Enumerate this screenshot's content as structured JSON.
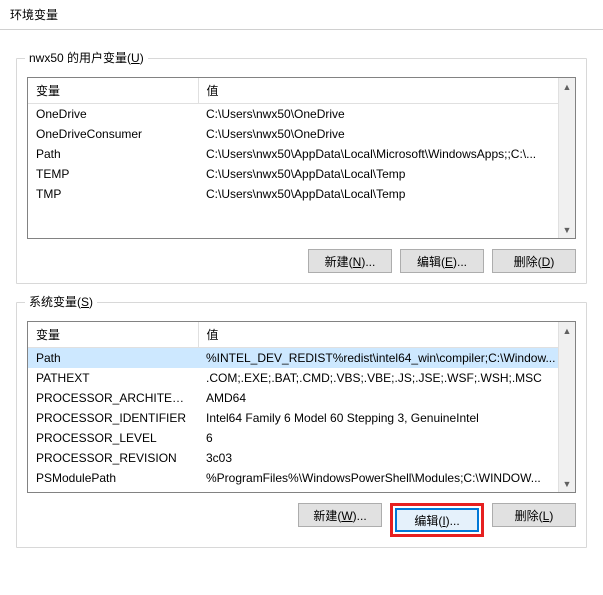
{
  "title": "环境变量",
  "user_group": {
    "label_prefix": "nwx50 的用户变量(",
    "label_key": "U",
    "label_suffix": ")",
    "headers": {
      "var": "变量",
      "val": "值"
    },
    "rows": [
      {
        "var": "OneDrive",
        "val": "C:\\Users\\nwx50\\OneDrive"
      },
      {
        "var": "OneDriveConsumer",
        "val": "C:\\Users\\nwx50\\OneDrive"
      },
      {
        "var": "Path",
        "val": "C:\\Users\\nwx50\\AppData\\Local\\Microsoft\\WindowsApps;;C:\\..."
      },
      {
        "var": "TEMP",
        "val": "C:\\Users\\nwx50\\AppData\\Local\\Temp"
      },
      {
        "var": "TMP",
        "val": "C:\\Users\\nwx50\\AppData\\Local\\Temp"
      }
    ],
    "buttons": {
      "new_pre": "新建(",
      "new_key": "N",
      "new_post": ")...",
      "edit_pre": "编辑(",
      "edit_key": "E",
      "edit_post": ")...",
      "del_pre": "删除(",
      "del_key": "D",
      "del_post": ")"
    }
  },
  "system_group": {
    "label_prefix": "系统变量(",
    "label_key": "S",
    "label_suffix": ")",
    "headers": {
      "var": "变量",
      "val": "值"
    },
    "rows": [
      {
        "var": "Path",
        "val": "%INTEL_DEV_REDIST%redist\\intel64_win\\compiler;C:\\Window..."
      },
      {
        "var": "PATHEXT",
        "val": ".COM;.EXE;.BAT;.CMD;.VBS;.VBE;.JS;.JSE;.WSF;.WSH;.MSC"
      },
      {
        "var": "PROCESSOR_ARCHITECT...",
        "val": "AMD64"
      },
      {
        "var": "PROCESSOR_IDENTIFIER",
        "val": "Intel64 Family 6 Model 60 Stepping 3, GenuineIntel"
      },
      {
        "var": "PROCESSOR_LEVEL",
        "val": "6"
      },
      {
        "var": "PROCESSOR_REVISION",
        "val": "3c03"
      },
      {
        "var": "PSModulePath",
        "val": "%ProgramFiles%\\WindowsPowerShell\\Modules;C:\\WINDOW..."
      }
    ],
    "buttons": {
      "new_pre": "新建(",
      "new_key": "W",
      "new_post": ")...",
      "edit_pre": "编辑(",
      "edit_key": "I",
      "edit_post": ")...",
      "del_pre": "删除(",
      "del_key": "L",
      "del_post": ")"
    }
  },
  "arrows": {
    "up": "▲",
    "down": "▼"
  }
}
